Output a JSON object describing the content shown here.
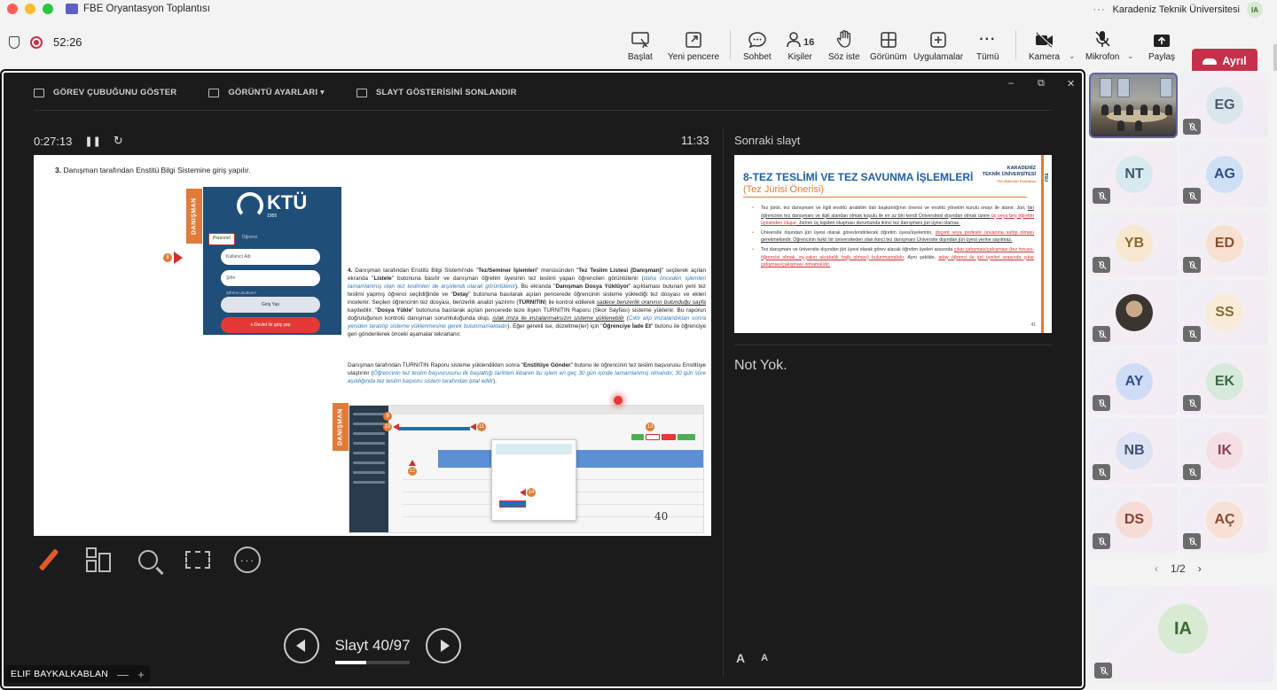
{
  "window": {
    "title": "FBE Oryantasyon Toplantısı",
    "org_name": "Karadeniz Teknik Üniversitesi",
    "org_initials": "IA",
    "more": "···"
  },
  "meeting": {
    "elapsed": "52:26"
  },
  "toolbar": {
    "share": "Başlat",
    "new_window": "Yeni pencere",
    "chat": "Sohbet",
    "people": "Kişiler",
    "people_count": "16",
    "raise_hand": "Söz iste",
    "view": "Görünüm",
    "apps": "Uygulamalar",
    "more": "Tümü",
    "camera": "Kamera",
    "mic": "Mikrofon",
    "share_screen": "Paylaş",
    "leave": "Ayrıl",
    "colors": {
      "leave": "#c4314b",
      "accent": "#6264a7"
    }
  },
  "presenter_view": {
    "top_actions": [
      "GÖREV ÇUBUĞUNU GÖSTER",
      "GÖRÜNTÜ AYARLARI ▾",
      "SLAYT GÖSTERİSİNİ SONLANDIR"
    ],
    "window_controls": [
      "–",
      "⧉",
      "✕"
    ],
    "timer": "0:27:13",
    "clock": "11:33",
    "next_slide_label": "Sonraki slayt",
    "notes": "Not Yok.",
    "slide_counter": "Slayt 40/97",
    "progress": 0.412,
    "font_increase": "A",
    "font_decrease": "A",
    "presenter_name": "ELIF BAYKALKABLAN",
    "presenter_controls": [
      "—",
      "+"
    ]
  },
  "current_slide": {
    "step3": "Danışman tarafından Enstitü Bilgi Sistemine giriş yapılır.",
    "step3_num": "3.",
    "side_label": "DANIŞMAN",
    "login": {
      "logo": "KTÜ",
      "year": "1955",
      "tab_active": "Personel",
      "tab_other": "Öğrenci",
      "user_field": "Kullanıcı Adı",
      "pass_field": "Şifre",
      "forgot": "Şifremi unuttum?",
      "login_btn": "Giriş Yap",
      "edevlet_btn": "e-Devlet ile giriş yap"
    },
    "marker_8": "8",
    "para1": {
      "n": "4.",
      "t1": "Danışman tarafından Enstitü Bilgi Sistemi'nde \"",
      "b1": "Tez/Seminer İşlemleri",
      "t2": "\" menüsünden \"",
      "b2": "Tez Teslim Listesi (Danışman)",
      "t3": "\" seçilerek açılan ekranda \"",
      "b3": "Listele",
      "t4": "\" butonuna basılır ve danışman öğretim üyesinin tez teslimi yapan öğrencileri görüntülenir (",
      "i1": "daha önceden işlemleri tamamlanmış olan tez teslimleri de arşivlendi olarak görüntülenir",
      "t5": "). Bu ekranda \"",
      "b4": "Danışman Dosya Yüklüyor",
      "t6": "\" açıklaması bulunan yeni tez teslimi yapmış öğrenci seçildiğinde ve \"",
      "b5": "Detay",
      "t7": "\" butonuna basılarak açılan pencerede öğrencinin sisteme yüklediği tez dosyası ve ekleri incelenir. Seçilen öğrencinin tez dosyası, benzerlik analizi yazılımı (",
      "b6": "TURNITIN",
      "t8": ") ile kontrol edilerek ",
      "u1": "sadece benzerlik oranının bulunduğu sayfa",
      "t9": " kaydedilir. \"",
      "b7": "Dosya Yükle",
      "t10": "\" butonuna basılarak açılan pencerede teze ilişkin TURNITIN Raporu (Skor Sayfası) sisteme yüklenir. Bu raporun doğruluğunun kontrolü danışman sorumluluğunda olup, ",
      "u2": "ıslak imza ile imzalanmaksızın sisteme yüklenebilir",
      "t11": " (",
      "i2": "Çıktı alıp imzalandıktan sonra yeniden taratılıp sisteme yüklenmesine gerek bulunmamaktadır",
      "t12": "). Eğer gerekli ise, düzeltme(ler) için \"",
      "b8": "Öğrenciye İade Et",
      "t13": "\" butonu ile öğrenciye geri gönderilerek önceki aşamalar tekrarlanır."
    },
    "para2": {
      "t1": "Danışman tarafından TURNITIN Raporu sisteme yüklendikten sonra \"",
      "b1": "Enstitüye Gönder",
      "t2": "\" butonu ile öğrencinin tez teslim başvurusu Enstitüye ulaştırılır (",
      "i1": "Öğrencinin tez teslim başvurusunu ilk başlattığı tarihten itibaren bu işlem en geç 30 gün içinde tamamlanmış olmalıdır, 30 gün süre aşıldığında tez teslim başvuru sistem tarafından iptal edilir",
      "t3": ")."
    },
    "markers": [
      "9",
      "10",
      "11",
      "12",
      "13",
      "14"
    ],
    "page_number": "40"
  },
  "next_slide": {
    "title": "8-TEZ TESLİMİ VE TEZ SAVUNMA İŞLEMLERİ",
    "subtitle": "(Tez Jürisi Önerisi)",
    "org_line1": "KARADENİZ",
    "org_line2": "TEKNİK ÜNİVERSİTESİ",
    "org_line3": "Fen Bilimleri Enstitüsü",
    "side": "FBE",
    "bullets": [
      {
        "a": "Tez jürisi, tez danışmanı ve ilgili enstitü anabilim dalı başkanlığının önerisi ve enstitü yönetim kurulu onayı ile atanır. Jüri, ",
        "u": "biri öğrencinin tez danışmanı ve ilgili alandan olmak koşulu ile en az biri kendi Üniversitesi dışından olmak üzere",
        "r": " üç veya beş öğretim üyesinden oluşur",
        "b": ". Jürinin üç kişiden oluşması durumunda ikinci tez danışmanı jüri üyesi olamaz."
      },
      {
        "a": "Üniversite dışından jüri üyesi olarak görevlendirilecek öğretim üyesi/üyelerinin, ",
        "r": "doçent veya profesör ünvanına sahip olması",
        "b": " gerekmektedir. Öğrencinin farklı bir üniversiteden olan ikinci tez danışmanı Üniversite dışından jüri üyesi yerine sayılmaz."
      },
      {
        "a": "Tez danışmanı ve üniversite dışından jüri üyesi olarak görev alacak öğretim üyeleri arasında ",
        "r": "çıkar çatışması/çakışması (tez hocası-öğrencisi olmak, eş-yakın akrabalık bağı olması) bulunmamalıdır",
        "b": ". Aynı şekilde, ",
        "r2": "aday öğrenci ile jüri üyeleri arasında çıkar çatışması/çakışması olmamalıdır."
      }
    ],
    "page": "41"
  },
  "participants": [
    {
      "initials": "",
      "video": "room",
      "muted": false
    },
    {
      "initials": "EG",
      "color": "#d9e6ee",
      "text": "#4a5a6a",
      "muted": true
    },
    {
      "initials": "NT",
      "color": "#d7eaf0",
      "text": "#3c5968",
      "muted": true
    },
    {
      "initials": "AG",
      "color": "#cfdff5",
      "text": "#2f4f7f",
      "muted": true
    },
    {
      "initials": "YB",
      "color": "#f7e8cf",
      "text": "#8a6a2f",
      "muted": true
    },
    {
      "initials": "ED",
      "color": "#f7e0cf",
      "text": "#8a4f2a",
      "muted": true
    },
    {
      "initials": "",
      "video": "photo",
      "muted": true
    },
    {
      "initials": "SS",
      "color": "#f8ecd9",
      "text": "#8a6a2f",
      "muted": true
    },
    {
      "initials": "AY",
      "color": "#cfdcf5",
      "text": "#2f4f8a",
      "muted": true
    },
    {
      "initials": "EK",
      "color": "#d5ead9",
      "text": "#3b6b4a",
      "muted": true
    },
    {
      "initials": "NB",
      "color": "#dde3f3",
      "text": "#3f4f7a",
      "muted": true
    },
    {
      "initials": "IK",
      "color": "#f5dfe4",
      "text": "#8a3f4f",
      "muted": true
    },
    {
      "initials": "DS",
      "color": "#f7dcd6",
      "text": "#8a3f2f",
      "muted": true
    },
    {
      "initials": "AÇ",
      "color": "#f7e0d4",
      "text": "#8a4a2f",
      "muted": true
    }
  ],
  "pager": {
    "label": "1/2",
    "prev": "‹",
    "next": "›"
  },
  "self": {
    "initials": "IA",
    "color": "#d7ead2",
    "text": "#3b6b2f"
  }
}
